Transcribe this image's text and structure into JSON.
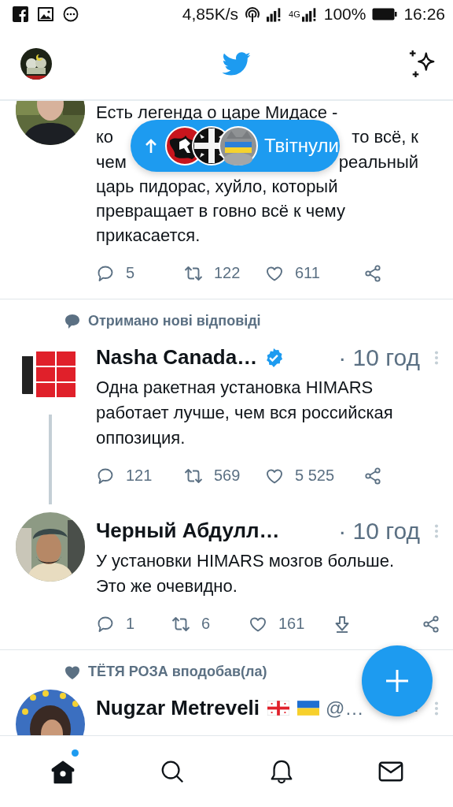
{
  "status_bar": {
    "speed": "4,85K/s",
    "network": "4G",
    "battery": "100%",
    "time": "16:26"
  },
  "new_tweets_pill": {
    "label": "Твітнули"
  },
  "tweets": [
    {
      "kind": "cut",
      "lines": [
        [
          "Есть легенда о царе Мидасе -"
        ],
        [
          "ко",
          "то всё, к"
        ],
        [
          "чем",
          "реальный"
        ],
        [
          "царь пидорас, хуйло, который"
        ],
        [
          "превращает в говно всё к чему"
        ],
        [
          "прикасается."
        ]
      ],
      "thread_down": false,
      "actions": [
        {
          "kind": "reply",
          "count": "5"
        },
        {
          "kind": "retweet",
          "count": "122"
        },
        {
          "kind": "like",
          "count": "611"
        },
        {
          "kind": "share"
        }
      ]
    },
    {
      "kind": "full",
      "context": {
        "kind": "reply",
        "text": "Отримано нові відповіді"
      },
      "name": "Nasha Canada…",
      "verified": true,
      "time": "· 10 год",
      "text": "Одна ракетная установка HIMARS работает лучше, чем вся российская оппозиция.",
      "thread_down": true,
      "actions": [
        {
          "kind": "reply",
          "count": "121"
        },
        {
          "kind": "retweet",
          "count": "569"
        },
        {
          "kind": "like",
          "count": "5 525"
        },
        {
          "kind": "share"
        }
      ]
    },
    {
      "kind": "full",
      "name": "Черный Абдулл…",
      "verified": false,
      "time": "· 10 год",
      "text": "У установки HIMARS мозгов больше. Это же очевидно.",
      "thread_down": false,
      "actions": [
        {
          "kind": "reply",
          "count": "1"
        },
        {
          "kind": "retweet",
          "count": "6"
        },
        {
          "kind": "like",
          "count": "161"
        },
        {
          "kind": "download"
        },
        {
          "kind": "share"
        }
      ]
    },
    {
      "kind": "full",
      "context": {
        "kind": "like",
        "text": "ТЁТЯ РОЗА вподобав(ла)"
      },
      "name": "Nugzar Metreveli",
      "flags": [
        {
          "kind": "georgia"
        },
        {
          "kind": "ukraine"
        }
      ],
      "handle": "@…",
      "verified": false,
      "time": "·",
      "thread_down": false
    }
  ],
  "nav": [
    {
      "kind": "home",
      "selected": true,
      "unread": true
    },
    {
      "kind": "search",
      "selected": false,
      "unread": false
    },
    {
      "kind": "notifications",
      "selected": false,
      "unread": false
    },
    {
      "kind": "messages",
      "selected": false,
      "unread": false
    }
  ]
}
